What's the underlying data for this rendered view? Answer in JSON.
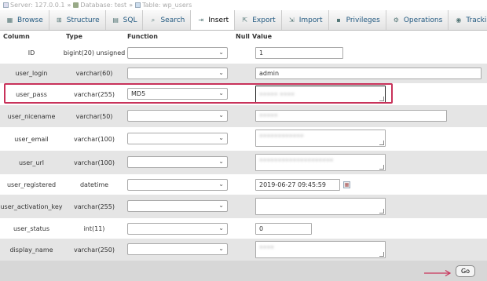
{
  "breadcrumb": {
    "server": "Server: 127.0.0.1",
    "database": "Database: test",
    "table": "Table: wp_users"
  },
  "tabs": [
    {
      "label": "Browse",
      "icon": "browse-icon"
    },
    {
      "label": "Structure",
      "icon": "structure-icon"
    },
    {
      "label": "SQL",
      "icon": "sql-icon"
    },
    {
      "label": "Search",
      "icon": "search-icon"
    },
    {
      "label": "Insert",
      "icon": "insert-icon",
      "active": true
    },
    {
      "label": "Export",
      "icon": "export-icon"
    },
    {
      "label": "Import",
      "icon": "import-icon"
    },
    {
      "label": "Privileges",
      "icon": "privileges-icon"
    },
    {
      "label": "Operations",
      "icon": "operations-icon"
    },
    {
      "label": "Tracking",
      "icon": "tracking-icon"
    }
  ],
  "headers": {
    "column": "Column",
    "type": "Type",
    "function": "Function",
    "null": "Null",
    "value": "Value"
  },
  "rows": [
    {
      "column": "ID",
      "type": "bigint(20) unsigned",
      "function": "",
      "value": "1"
    },
    {
      "column": "user_login",
      "type": "varchar(60)",
      "function": "",
      "value": "admin"
    },
    {
      "column": "user_pass",
      "type": "varchar(255)",
      "function": "MD5",
      "value": "",
      "highlighted": true
    },
    {
      "column": "user_nicename",
      "type": "varchar(50)",
      "function": "",
      "value": ""
    },
    {
      "column": "user_email",
      "type": "varchar(100)",
      "function": "",
      "value": ""
    },
    {
      "column": "user_url",
      "type": "varchar(100)",
      "function": "",
      "value": ""
    },
    {
      "column": "user_registered",
      "type": "datetime",
      "function": "",
      "value": "2019-06-27 09:45:59"
    },
    {
      "column": "user_activation_key",
      "type": "varchar(255)",
      "function": "",
      "value": ""
    },
    {
      "column": "user_status",
      "type": "int(11)",
      "function": "",
      "value": "0"
    },
    {
      "column": "display_name",
      "type": "varchar(250)",
      "function": "",
      "value": ""
    }
  ],
  "footer": {
    "go_label": "Go"
  },
  "colors": {
    "highlight": "#c8325a",
    "tab_text": "#235a81",
    "row_alt": "#e5e5e5"
  }
}
